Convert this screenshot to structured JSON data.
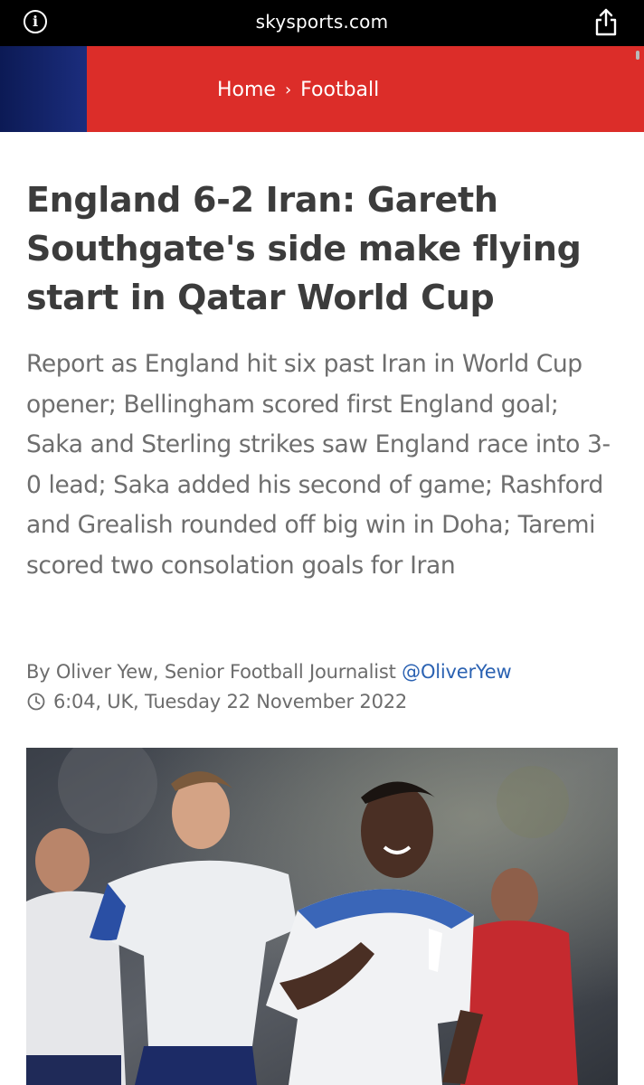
{
  "browser": {
    "url": "skysports.com",
    "info_icon": "info-icon",
    "share_icon": "share-icon"
  },
  "nav": {
    "breadcrumb": [
      "Home",
      "Football"
    ],
    "separator": "›"
  },
  "article": {
    "title": "England 6-2 Iran: Gareth Southgate's side make flying start in Qatar World Cup",
    "standfirst": "Report as England hit six past Iran in World Cup opener; Bellingham scored first England goal; Saka and Sterling strikes saw England race into 3-0 lead; Saka added his second of game; Rashford and Grealish rounded off big win in Doha; Taremi scored two consolation goals for Iran",
    "byline_prefix": "By Oliver Yew, Senior Football Journalist",
    "author_handle": "@OliverYew",
    "published": "6:04, UK, Tuesday 22 November 2022",
    "clock_icon": "clock-icon"
  },
  "colors": {
    "nav_red": "#dc2d29",
    "nav_blue": "#1b2d7d",
    "handle_blue": "#2b62b2",
    "title_text": "#3c3c3c",
    "body_text": "#6e6e6e"
  }
}
